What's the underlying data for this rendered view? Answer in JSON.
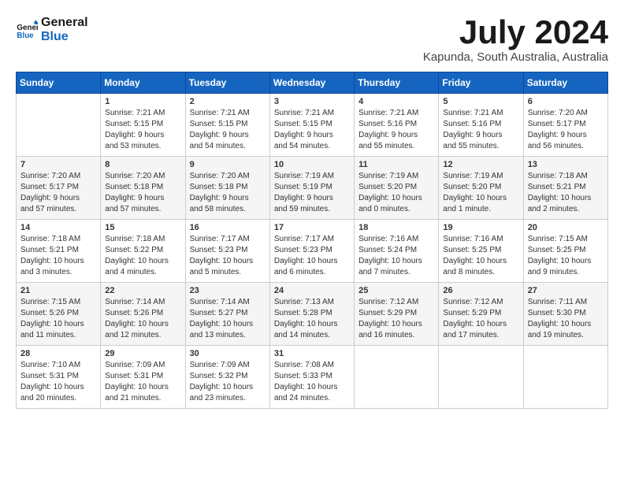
{
  "header": {
    "logo_line1": "General",
    "logo_line2": "Blue",
    "month": "July 2024",
    "location": "Kapunda, South Australia, Australia"
  },
  "weekdays": [
    "Sunday",
    "Monday",
    "Tuesday",
    "Wednesday",
    "Thursday",
    "Friday",
    "Saturday"
  ],
  "weeks": [
    [
      {
        "day": "",
        "content": ""
      },
      {
        "day": "1",
        "content": "Sunrise: 7:21 AM\nSunset: 5:15 PM\nDaylight: 9 hours\nand 53 minutes."
      },
      {
        "day": "2",
        "content": "Sunrise: 7:21 AM\nSunset: 5:15 PM\nDaylight: 9 hours\nand 54 minutes."
      },
      {
        "day": "3",
        "content": "Sunrise: 7:21 AM\nSunset: 5:15 PM\nDaylight: 9 hours\nand 54 minutes."
      },
      {
        "day": "4",
        "content": "Sunrise: 7:21 AM\nSunset: 5:16 PM\nDaylight: 9 hours\nand 55 minutes."
      },
      {
        "day": "5",
        "content": "Sunrise: 7:21 AM\nSunset: 5:16 PM\nDaylight: 9 hours\nand 55 minutes."
      },
      {
        "day": "6",
        "content": "Sunrise: 7:20 AM\nSunset: 5:17 PM\nDaylight: 9 hours\nand 56 minutes."
      }
    ],
    [
      {
        "day": "7",
        "content": "Sunrise: 7:20 AM\nSunset: 5:17 PM\nDaylight: 9 hours\nand 57 minutes."
      },
      {
        "day": "8",
        "content": "Sunrise: 7:20 AM\nSunset: 5:18 PM\nDaylight: 9 hours\nand 57 minutes."
      },
      {
        "day": "9",
        "content": "Sunrise: 7:20 AM\nSunset: 5:18 PM\nDaylight: 9 hours\nand 58 minutes."
      },
      {
        "day": "10",
        "content": "Sunrise: 7:19 AM\nSunset: 5:19 PM\nDaylight: 9 hours\nand 59 minutes."
      },
      {
        "day": "11",
        "content": "Sunrise: 7:19 AM\nSunset: 5:20 PM\nDaylight: 10 hours\nand 0 minutes."
      },
      {
        "day": "12",
        "content": "Sunrise: 7:19 AM\nSunset: 5:20 PM\nDaylight: 10 hours\nand 1 minute."
      },
      {
        "day": "13",
        "content": "Sunrise: 7:18 AM\nSunset: 5:21 PM\nDaylight: 10 hours\nand 2 minutes."
      }
    ],
    [
      {
        "day": "14",
        "content": "Sunrise: 7:18 AM\nSunset: 5:21 PM\nDaylight: 10 hours\nand 3 minutes."
      },
      {
        "day": "15",
        "content": "Sunrise: 7:18 AM\nSunset: 5:22 PM\nDaylight: 10 hours\nand 4 minutes."
      },
      {
        "day": "16",
        "content": "Sunrise: 7:17 AM\nSunset: 5:23 PM\nDaylight: 10 hours\nand 5 minutes."
      },
      {
        "day": "17",
        "content": "Sunrise: 7:17 AM\nSunset: 5:23 PM\nDaylight: 10 hours\nand 6 minutes."
      },
      {
        "day": "18",
        "content": "Sunrise: 7:16 AM\nSunset: 5:24 PM\nDaylight: 10 hours\nand 7 minutes."
      },
      {
        "day": "19",
        "content": "Sunrise: 7:16 AM\nSunset: 5:25 PM\nDaylight: 10 hours\nand 8 minutes."
      },
      {
        "day": "20",
        "content": "Sunrise: 7:15 AM\nSunset: 5:25 PM\nDaylight: 10 hours\nand 9 minutes."
      }
    ],
    [
      {
        "day": "21",
        "content": "Sunrise: 7:15 AM\nSunset: 5:26 PM\nDaylight: 10 hours\nand 11 minutes."
      },
      {
        "day": "22",
        "content": "Sunrise: 7:14 AM\nSunset: 5:26 PM\nDaylight: 10 hours\nand 12 minutes."
      },
      {
        "day": "23",
        "content": "Sunrise: 7:14 AM\nSunset: 5:27 PM\nDaylight: 10 hours\nand 13 minutes."
      },
      {
        "day": "24",
        "content": "Sunrise: 7:13 AM\nSunset: 5:28 PM\nDaylight: 10 hours\nand 14 minutes."
      },
      {
        "day": "25",
        "content": "Sunrise: 7:12 AM\nSunset: 5:29 PM\nDaylight: 10 hours\nand 16 minutes."
      },
      {
        "day": "26",
        "content": "Sunrise: 7:12 AM\nSunset: 5:29 PM\nDaylight: 10 hours\nand 17 minutes."
      },
      {
        "day": "27",
        "content": "Sunrise: 7:11 AM\nSunset: 5:30 PM\nDaylight: 10 hours\nand 19 minutes."
      }
    ],
    [
      {
        "day": "28",
        "content": "Sunrise: 7:10 AM\nSunset: 5:31 PM\nDaylight: 10 hours\nand 20 minutes."
      },
      {
        "day": "29",
        "content": "Sunrise: 7:09 AM\nSunset: 5:31 PM\nDaylight: 10 hours\nand 21 minutes."
      },
      {
        "day": "30",
        "content": "Sunrise: 7:09 AM\nSunset: 5:32 PM\nDaylight: 10 hours\nand 23 minutes."
      },
      {
        "day": "31",
        "content": "Sunrise: 7:08 AM\nSunset: 5:33 PM\nDaylight: 10 hours\nand 24 minutes."
      },
      {
        "day": "",
        "content": ""
      },
      {
        "day": "",
        "content": ""
      },
      {
        "day": "",
        "content": ""
      }
    ]
  ]
}
